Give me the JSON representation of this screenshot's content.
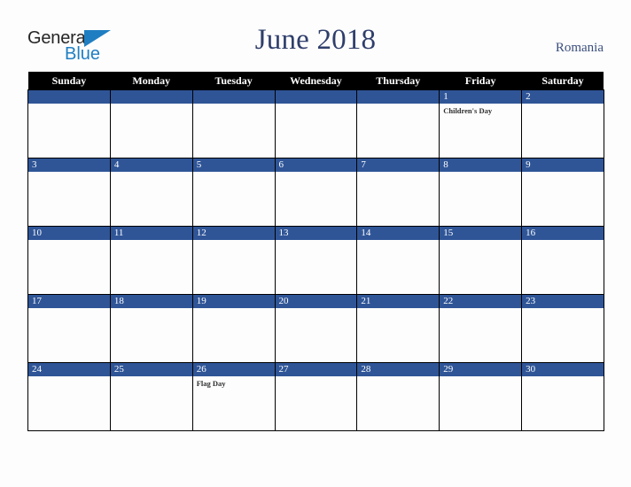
{
  "logo": {
    "word_one": "General",
    "word_two": "Blue",
    "triangle_icon": "blue-triangle-icon",
    "colors": {
      "word_one": "#252525",
      "word_two": "#1f7ec2",
      "triangle": "#1f7ec2"
    }
  },
  "header": {
    "title": "June 2018",
    "country": "Romania",
    "title_color": "#2f3e6b",
    "country_color": "#3b4f7d"
  },
  "theme": {
    "page_background": "#fdfdfd",
    "weekday_header_background": "#000000",
    "weekday_header_text": "#ffffff",
    "date_banner_background": "#2f5597",
    "date_banner_text": "#ffffff",
    "cell_border": "#000000",
    "cell_background": "#fdfdfd",
    "event_text": "#303030"
  },
  "calendar": {
    "weekdays": [
      "Sunday",
      "Monday",
      "Tuesday",
      "Wednesday",
      "Thursday",
      "Friday",
      "Saturday"
    ],
    "weeks": [
      [
        {
          "date": "",
          "events": []
        },
        {
          "date": "",
          "events": []
        },
        {
          "date": "",
          "events": []
        },
        {
          "date": "",
          "events": []
        },
        {
          "date": "",
          "events": []
        },
        {
          "date": "1",
          "events": [
            "Children's Day"
          ]
        },
        {
          "date": "2",
          "events": []
        }
      ],
      [
        {
          "date": "3",
          "events": []
        },
        {
          "date": "4",
          "events": []
        },
        {
          "date": "5",
          "events": []
        },
        {
          "date": "6",
          "events": []
        },
        {
          "date": "7",
          "events": []
        },
        {
          "date": "8",
          "events": []
        },
        {
          "date": "9",
          "events": []
        }
      ],
      [
        {
          "date": "10",
          "events": []
        },
        {
          "date": "11",
          "events": []
        },
        {
          "date": "12",
          "events": []
        },
        {
          "date": "13",
          "events": []
        },
        {
          "date": "14",
          "events": []
        },
        {
          "date": "15",
          "events": []
        },
        {
          "date": "16",
          "events": []
        }
      ],
      [
        {
          "date": "17",
          "events": []
        },
        {
          "date": "18",
          "events": []
        },
        {
          "date": "19",
          "events": []
        },
        {
          "date": "20",
          "events": []
        },
        {
          "date": "21",
          "events": []
        },
        {
          "date": "22",
          "events": []
        },
        {
          "date": "23",
          "events": []
        }
      ],
      [
        {
          "date": "24",
          "events": []
        },
        {
          "date": "25",
          "events": []
        },
        {
          "date": "26",
          "events": [
            "Flag Day"
          ]
        },
        {
          "date": "27",
          "events": []
        },
        {
          "date": "28",
          "events": []
        },
        {
          "date": "29",
          "events": []
        },
        {
          "date": "30",
          "events": []
        }
      ]
    ]
  }
}
